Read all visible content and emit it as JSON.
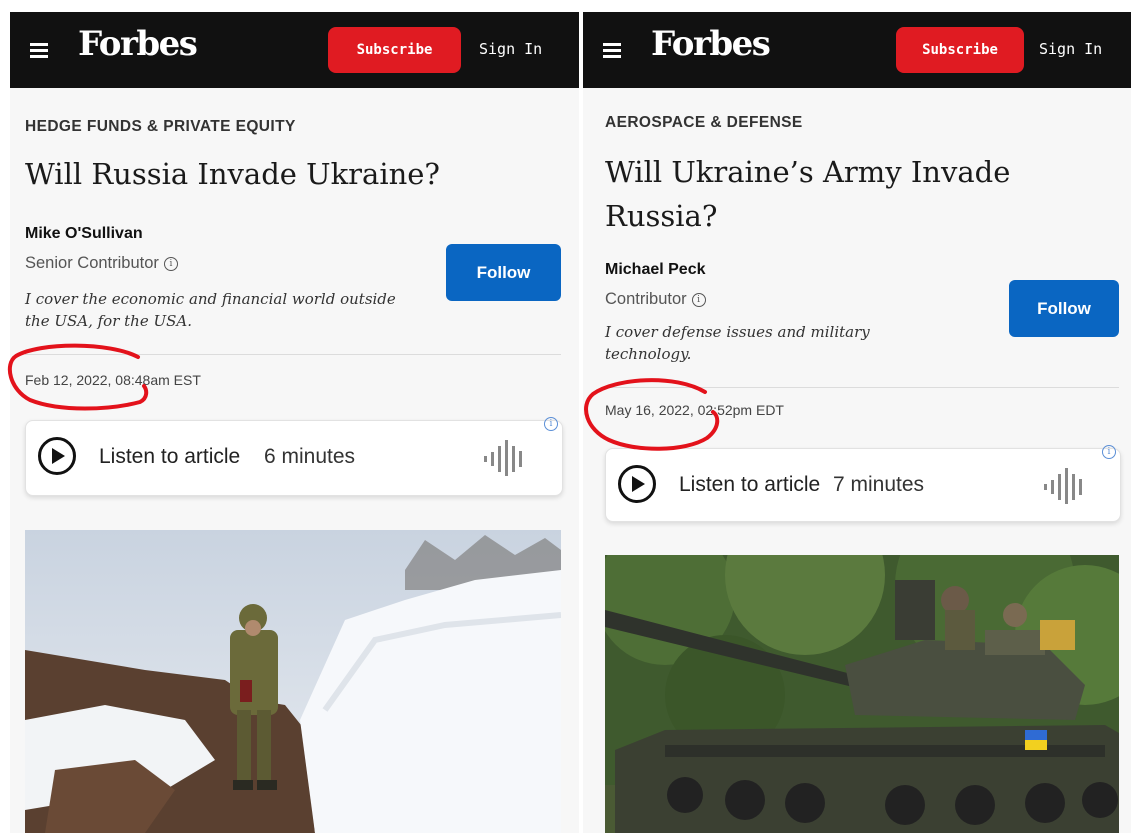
{
  "left": {
    "brand": "Forbes",
    "subscribe_label": "Subscribe",
    "signin_label": "Sign In",
    "category": "HEDGE FUNDS & PRIVATE EQUITY",
    "headline": "Will Russia Invade Ukraine?",
    "author": "Mike O'Sullivan",
    "role": "Senior Contributor",
    "bio": "I cover the economic and financial world outside the USA, for the USA.",
    "follow_label": "Follow",
    "date": "Feb 12, 2022, 08:48am EST",
    "audio": {
      "label": "Listen to article",
      "duration": "6 minutes"
    }
  },
  "right": {
    "brand": "Forbes",
    "subscribe_label": "Subscribe",
    "signin_label": "Sign In",
    "category": "AEROSPACE & DEFENSE",
    "headline": "Will Ukraine’s Army Invade Russia?",
    "author": "Michael Peck",
    "role": "Contributor",
    "bio": "I cover defense issues and military technology.",
    "follow_label": "Follow",
    "date": "May 16, 2022, 02:52pm EDT",
    "audio": {
      "label": "Listen to article",
      "duration": "7 minutes"
    }
  },
  "colors": {
    "topbar": "#111111",
    "subscribe": "#e01b22",
    "follow": "#0a66c2",
    "annotation": "#e3121b"
  },
  "icons": {
    "menu": "hamburger-icon",
    "info": "info-icon",
    "play": "play-icon",
    "waveform": "waveform-icon"
  }
}
